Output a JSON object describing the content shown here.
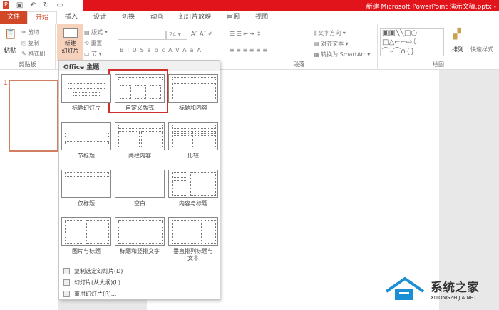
{
  "window": {
    "title": "新建 Microsoft PowerPoint 演示文稿.pptx -"
  },
  "tabs": [
    "文件",
    "开始",
    "插入",
    "设计",
    "切换",
    "动画",
    "幻灯片放映",
    "审阅",
    "视图"
  ],
  "clipboard": {
    "paste": "粘贴",
    "cut": "剪切",
    "copy": "复制",
    "format_painter": "格式刷",
    "group": "剪贴板"
  },
  "slides": {
    "new_slide_line1": "新建",
    "new_slide_line2": "幻灯片",
    "layout": "版式",
    "reset": "重置",
    "section": "节"
  },
  "font": {
    "size": "24"
  },
  "paragraph": {
    "text_direction": "文字方向",
    "align_text": "对齐文本",
    "smartart": "转换为 SmartArt",
    "group": "段落"
  },
  "drawing": {
    "arrange": "排列",
    "quick_styles": "快速样式",
    "group": "绘图"
  },
  "slide_panel": {
    "number": "1"
  },
  "menu": {
    "header": "Office 主题",
    "layouts": [
      "标题幻灯片",
      "自定义版式",
      "标题和内容",
      "节标题",
      "两栏内容",
      "比较",
      "仅标题",
      "空白",
      "内容与标题",
      "图片与标题",
      "标题和竖排文字",
      "垂直排列标题与文本"
    ],
    "selected_index": 1,
    "items": [
      "复制选定幻灯片(D)",
      "幻灯片(从大纲)(L)...",
      "重用幻灯片(R)..."
    ]
  },
  "watermark": {
    "name": "系统之家",
    "url": "XITONGZHIJIA.NET"
  },
  "colors": {
    "accent": "#d24726",
    "titlebar": "#e0141a",
    "selection": "#d0312d"
  }
}
